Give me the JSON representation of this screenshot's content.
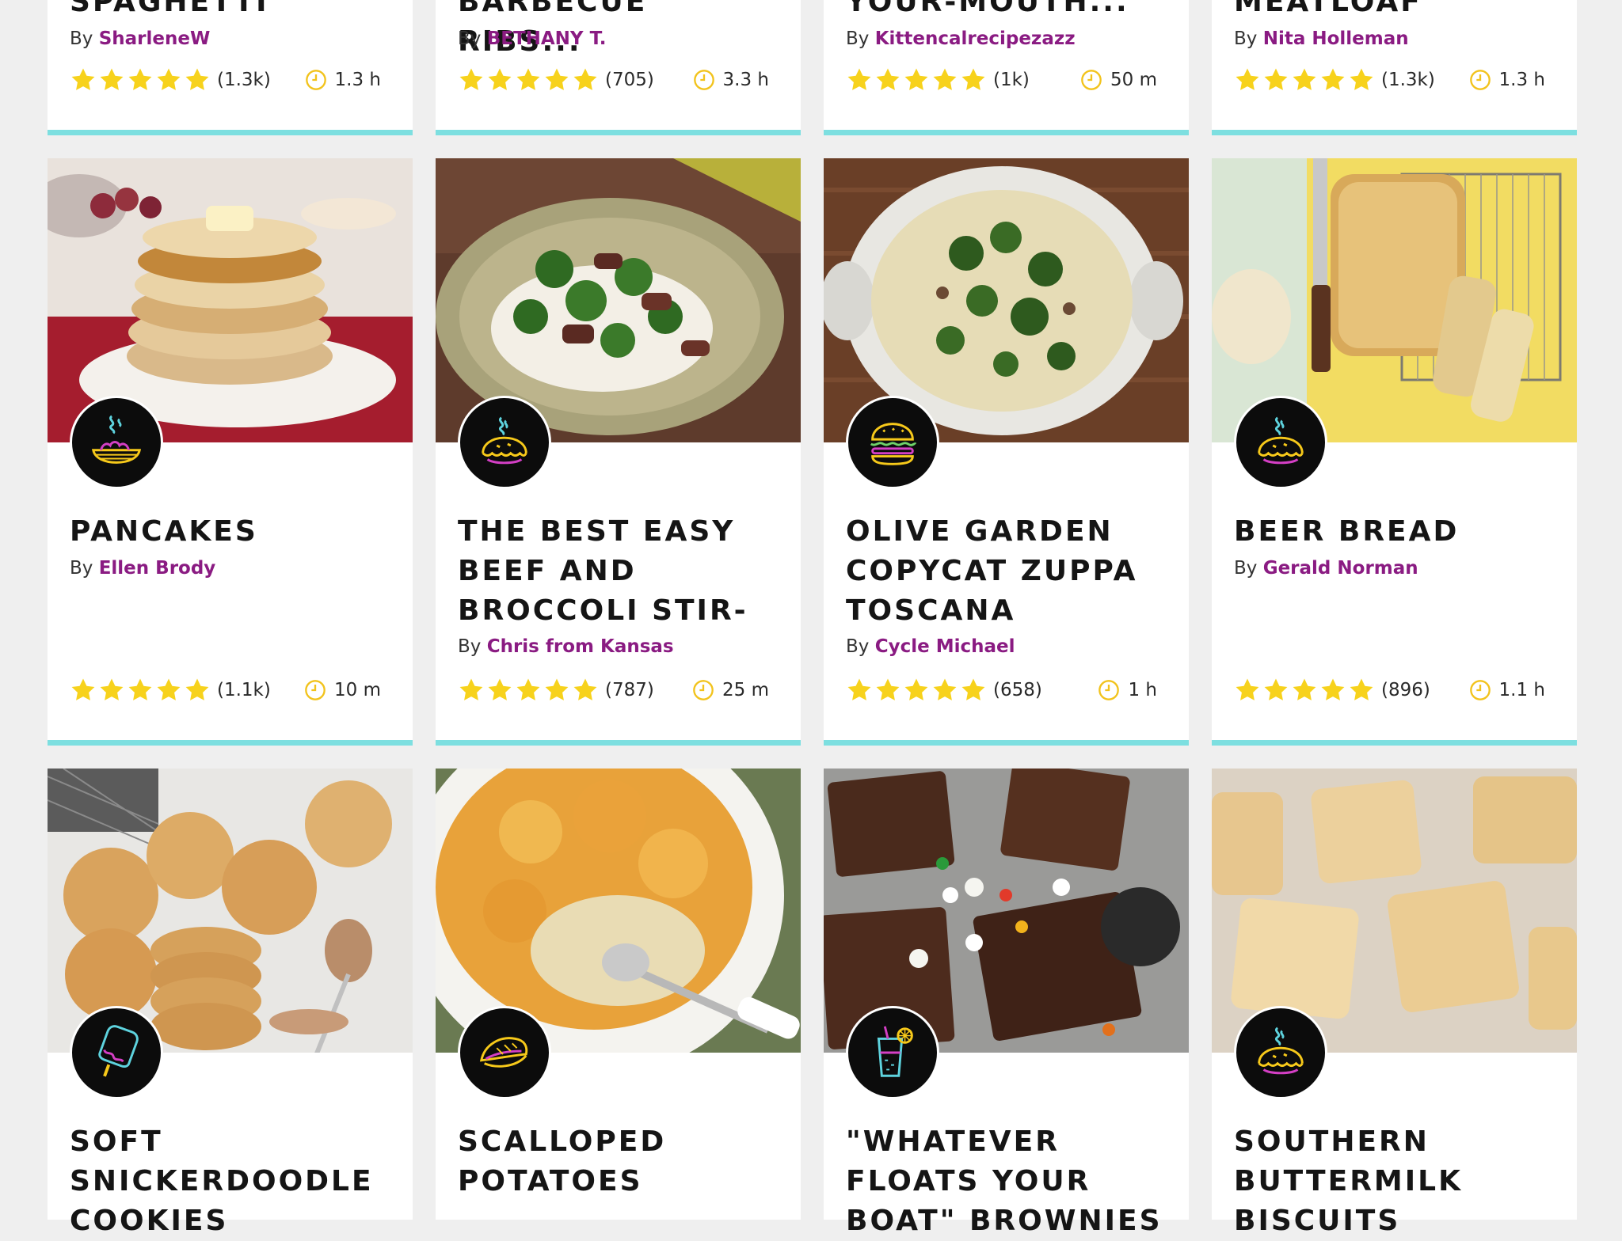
{
  "top_row": [
    {
      "title": "Spaghetti",
      "by": "By",
      "author": "SharleneW",
      "reviews": "(1.3k)",
      "time": "1.3 h"
    },
    {
      "title": "Barbecue Ribs...",
      "by": "By",
      "author": "BETHANY T.",
      "reviews": "(705)",
      "time": "3.3 h"
    },
    {
      "title": "Your-Mouth...",
      "by": "By",
      "author": "Kittencalrecipezazz",
      "reviews": "(1k)",
      "time": "50 m"
    },
    {
      "title": "Meatloaf",
      "by": "By",
      "author": "Nita Holleman",
      "reviews": "(1.3k)",
      "time": "1.3 h"
    }
  ],
  "middle_row": [
    {
      "title": "Pancakes",
      "by": "By",
      "author": "Ellen Brody",
      "reviews": "(1.1k)",
      "time": "10 m",
      "badge_icon": "noodle-bowl-icon",
      "image": "pancakes-photo"
    },
    {
      "title": "The Best Easy Beef and Broccoli Stir-",
      "by": "By",
      "author": "Chris from Kansas",
      "reviews": "(787)",
      "time": "25 m",
      "badge_icon": "pie-icon",
      "image": "beef-broccoli-photo"
    },
    {
      "title": "Olive Garden Copycat Zuppa Toscana",
      "by": "By",
      "author": "Cycle Michael",
      "reviews": "(658)",
      "time": "1 h",
      "badge_icon": "burger-icon",
      "image": "soup-pot-photo"
    },
    {
      "title": "Beer Bread",
      "by": "By",
      "author": "Gerald Norman",
      "reviews": "(896)",
      "time": "1.1 h",
      "badge_icon": "pie-icon",
      "image": "beer-bread-photo"
    }
  ],
  "bottom_row": [
    {
      "title": "Soft Snickerdoodle Cookies",
      "badge_icon": "popsicle-icon",
      "image": "cookies-photo"
    },
    {
      "title": "Scalloped Potatoes",
      "badge_icon": "taco-icon",
      "image": "scalloped-potatoes-photo"
    },
    {
      "title": "\"Whatever Floats Your Boat\" Brownies",
      "badge_icon": "drink-icon",
      "image": "brownies-photo"
    },
    {
      "title": "Southern Buttermilk Biscuits",
      "badge_icon": "pie-icon",
      "image": "biscuits-photo"
    }
  ],
  "rating_stars": 5,
  "colors": {
    "star": "#f7d21c",
    "author": "#8a1b82",
    "accent_border": "#7ddfe0",
    "clock": "#f2c31c"
  }
}
